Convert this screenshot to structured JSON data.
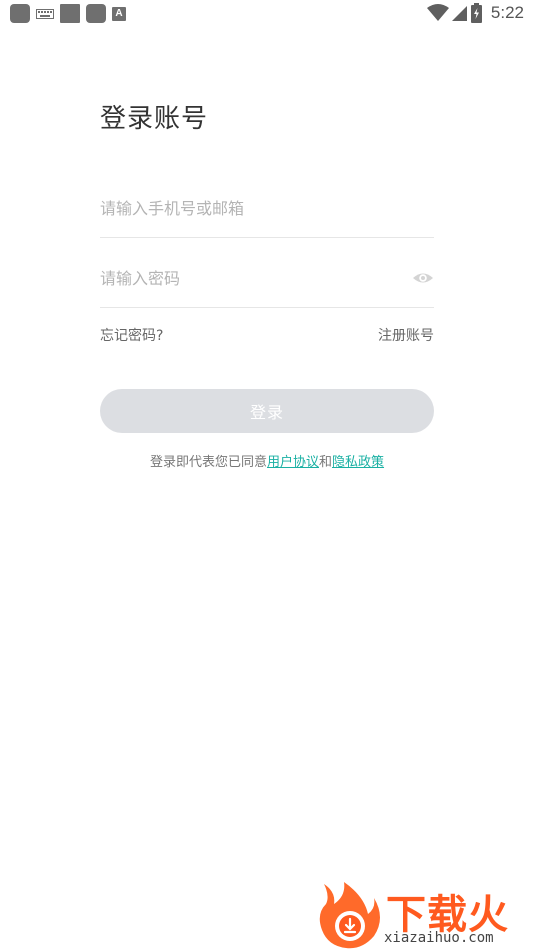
{
  "status_bar": {
    "time": "5:22",
    "left_icons": [
      "app-icon",
      "keyboard-icon",
      "app-icon",
      "app-icon",
      "font-a-icon"
    ],
    "right_icons": [
      "wifi-icon",
      "cell-signal-icon",
      "battery-charging-icon"
    ],
    "a_glyph": "A"
  },
  "login": {
    "title": "登录账号",
    "phone_placeholder": "请输入手机号或邮箱",
    "password_placeholder": "请输入密码",
    "forgot_label": "忘记密码?",
    "register_label": "注册账号",
    "login_button_label": "登录",
    "login_button_color": "#dcdee2"
  },
  "agreement": {
    "prefix": "登录即代表您已同意",
    "user_agreement_link": "用户协议",
    "conjunction": "和",
    "privacy_link": "隐私政策",
    "link_color": "#1ab0a3"
  },
  "watermark": {
    "brand_text": "下载火",
    "url_text": "xiazaihuo.com",
    "brand_color": "#ff5a1f"
  }
}
